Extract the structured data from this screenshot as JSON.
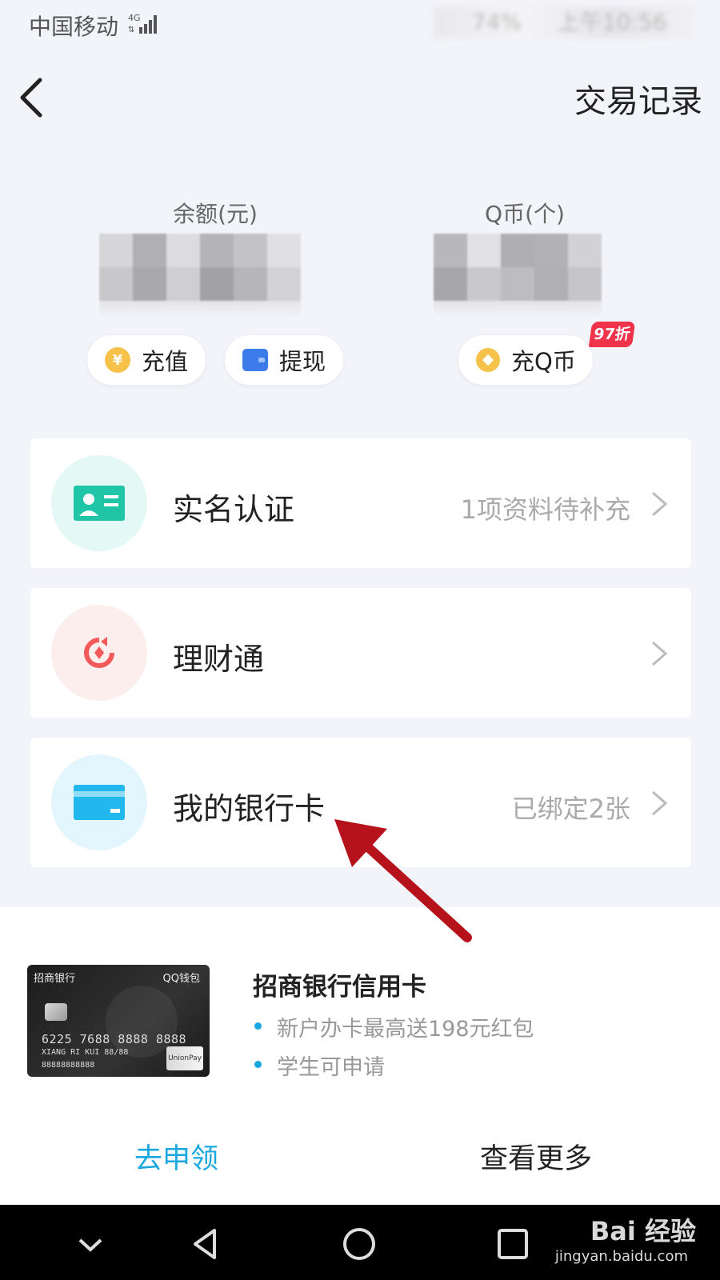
{
  "status_bar": {
    "carrier": "中国移动",
    "network": "4G",
    "battery": "74%",
    "time": "上午10:56"
  },
  "header": {
    "transaction_record": "交易记录"
  },
  "balance": {
    "yuan_label": "余额(元)",
    "qcoin_label": "Q币(个)",
    "recharge": "充值",
    "withdraw": "提现",
    "recharge_q": "充Q币",
    "discount_badge": "97折"
  },
  "cards": [
    {
      "label": "实名认证",
      "note": "1项资料待补充",
      "icon": "id-card-icon",
      "accent": "#20c4a6"
    },
    {
      "label": "理财通",
      "note": "",
      "icon": "licaitong-icon",
      "accent": "#f25a5a"
    },
    {
      "label": "我的银行卡",
      "note": "已绑定2张",
      "icon": "bank-card-icon",
      "accent": "#22b8ee"
    }
  ],
  "promo": {
    "title": "招商银行信用卡",
    "bullets": [
      "新户办卡最高送198元红包",
      "学生可申请"
    ],
    "apply": "去申领",
    "more": "查看更多",
    "card_art": {
      "bank": "招商银行",
      "wallet": "QQ钱包",
      "number": "6225 7688 8888 8888",
      "expiry": "88/88",
      "holder": "XIANG RI KUI",
      "account": "88888888888",
      "network": "UnionPay 银联"
    }
  },
  "nav": {
    "watermark": "Bai 经验",
    "watermark_url": "jingyan.baidu.com"
  },
  "colors": {
    "link": "#19a7e0",
    "badge": "#f0334a",
    "coin": "#f6c24a"
  }
}
